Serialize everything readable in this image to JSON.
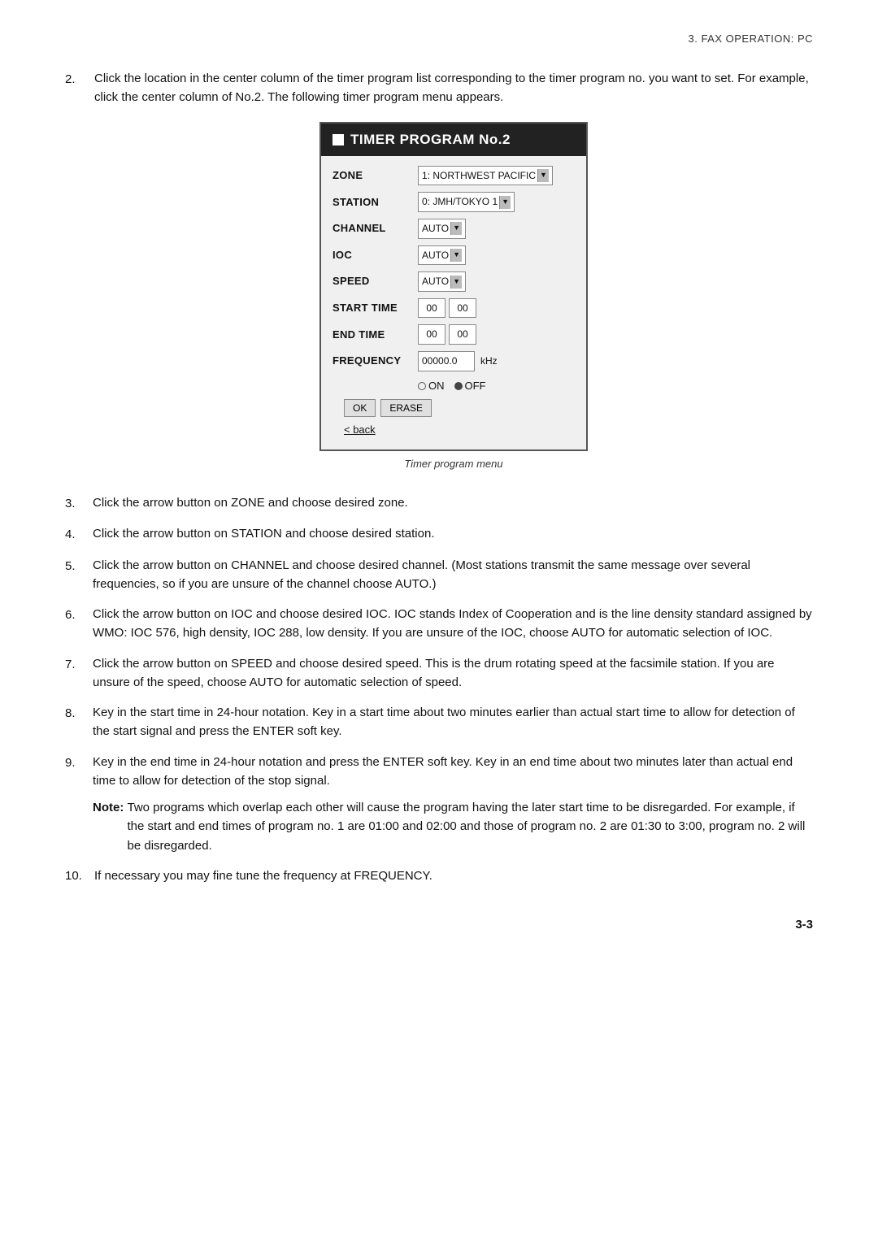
{
  "header": {
    "text": "3.  FAX  OPERATION:  PC"
  },
  "intro": {
    "num": "2.",
    "text": "Click the location in the center column of the timer program list corresponding to the timer program no. you want to set. For example, click the center column of No.2. The following timer program menu appears."
  },
  "dialog": {
    "title": "TIMER PROGRAM No.2",
    "fields": [
      {
        "label": "ZONE",
        "control": "select",
        "value": "1: NORTHWEST PACIFIC"
      },
      {
        "label": "STATION",
        "control": "select",
        "value": "0: JMH/TOKYO 1"
      },
      {
        "label": "CHANNEL",
        "control": "select",
        "value": "AUTO"
      },
      {
        "label": "IOC",
        "control": "select",
        "value": "AUTO"
      },
      {
        "label": "SPEED",
        "control": "select",
        "value": "AUTO"
      },
      {
        "label": "START TIME",
        "control": "time",
        "h": "00",
        "m": "00"
      },
      {
        "label": "END  TIME",
        "control": "time",
        "h": "00",
        "m": "00"
      },
      {
        "label": "FREQUENCY",
        "control": "freq",
        "value": "00000.0",
        "unit": "kHz"
      }
    ],
    "radio": {
      "on_label": "ON",
      "off_label": "OFF",
      "on_filled": false,
      "off_filled": true
    },
    "buttons": [
      "OK",
      "ERASE"
    ],
    "back": "< back"
  },
  "dialog_caption": "Timer program menu",
  "steps": [
    {
      "num": "3.",
      "text": "Click the arrow button on ZONE and choose desired zone."
    },
    {
      "num": "4.",
      "text": "Click the arrow button on STATION and choose desired station."
    },
    {
      "num": "5.",
      "text": "Click the arrow button on CHANNEL and choose desired channel. (Most stations transmit the same message over several frequencies, so if you are unsure of the channel choose AUTO.)"
    },
    {
      "num": "6.",
      "text": "Click the arrow button on IOC and choose desired IOC. IOC stands Index of Cooperation and is the line density standard assigned by WMO: IOC 576, high density, IOC 288, low density. If you are unsure of the IOC, choose AUTO for automatic selection of IOC."
    },
    {
      "num": "7.",
      "text": "Click the arrow button on SPEED and choose desired speed. This is the drum rotating speed at the facsimile station. If you are unsure of the speed, choose AUTO for automatic selection of speed."
    },
    {
      "num": "8.",
      "text": "Key in the start time in 24-hour notation. Key in a start time about two minutes earlier than actual start time to allow for detection of the start signal and press the ENTER soft key."
    },
    {
      "num": "9.",
      "text": "Key in the end time in 24-hour notation and press the ENTER soft key. Key in an end time about two minutes later than actual end time to allow for detection of the stop signal."
    }
  ],
  "note": {
    "label": "Note:",
    "text": "Two programs which overlap each other will cause the program having the later start time to be disregarded. For example, if the start and end times of program no. 1 are 01:00 and 02:00 and those of program no. 2 are 01:30 to 3:00, program no. 2 will be disregarded."
  },
  "step10": {
    "num": "10.",
    "text": "If necessary you may fine tune the frequency at FREQUENCY."
  },
  "page_number": "3-3"
}
